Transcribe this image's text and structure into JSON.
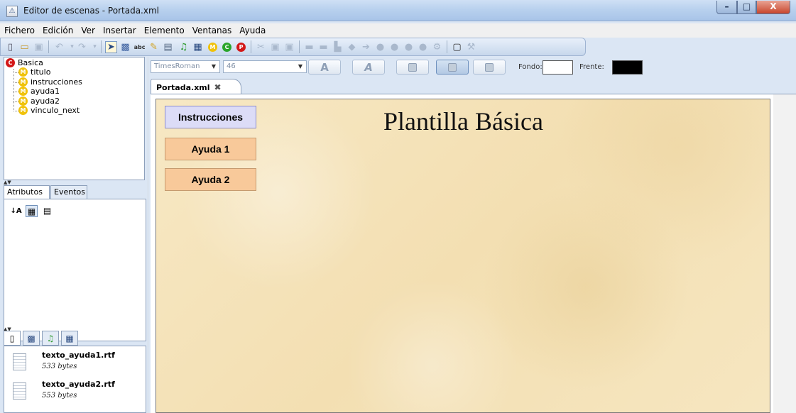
{
  "window": {
    "title": "Editor de escenas - Portada.xml",
    "controls": {
      "minimize": "–",
      "maximize": "□",
      "close": "X"
    }
  },
  "menu": [
    "Fichero",
    "Edición",
    "Ver",
    "Insertar",
    "Elemento",
    "Ventanas",
    "Ayuda"
  ],
  "toolbar_icons": [
    "new-icon",
    "open-icon",
    "save-icon",
    "undo-icon",
    "redo-icon",
    "select-arrow-icon",
    "image-icon",
    "text-icon",
    "edit-icon",
    "list-icon",
    "music-icon",
    "film-icon",
    "m-icon",
    "c-icon",
    "p-icon",
    "cut-icon",
    "copy-icon",
    "paste-icon",
    "align-icon",
    "arrow-left-icon",
    "arrow-right-icon",
    "settings-icon",
    "frame-icon",
    "wrench-icon"
  ],
  "tree": {
    "root": {
      "icon": "C",
      "label": "Basica"
    },
    "children": [
      {
        "icon": "M",
        "label": "titulo"
      },
      {
        "icon": "M",
        "label": "instrucciones"
      },
      {
        "icon": "M",
        "label": "ayuda1"
      },
      {
        "icon": "M",
        "label": "ayuda2"
      },
      {
        "icon": "M",
        "label": "vinculo_next"
      }
    ]
  },
  "attr_panel": {
    "tabs": [
      "Atributos",
      "Eventos"
    ],
    "tools": {
      "sort": "↓A",
      "categorized": "▦",
      "list": "▤"
    }
  },
  "resources": {
    "tab_icons": [
      "page-icon",
      "image-icon",
      "music-icon",
      "film-icon"
    ],
    "files": [
      {
        "name": "texto_ayuda1.rtf",
        "size": "533 bytes"
      },
      {
        "name": "texto_ayuda2.rtf",
        "size": "553 bytes"
      }
    ]
  },
  "format_bar": {
    "font": "TimesRoman",
    "size": "46",
    "bold_glyph": "A",
    "italic_glyph": "A",
    "fondo_label": "Fondo:",
    "frente_label": "Frente:",
    "fondo_color": "#ffffff",
    "frente_color": "#000000"
  },
  "doc_tab": {
    "label": "Portada.xml",
    "close": "✖"
  },
  "scene": {
    "title": "Plantilla Básica",
    "buttons": [
      {
        "label": "Instrucciones",
        "color": "#dcdcf7"
      },
      {
        "label": "Ayuda 1",
        "color": "#f8c99a"
      },
      {
        "label": "Ayuda 2",
        "color": "#f8c99a"
      }
    ]
  }
}
